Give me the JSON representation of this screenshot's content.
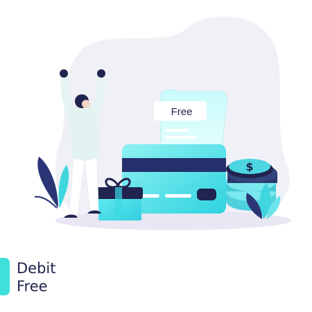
{
  "receipt": {
    "label": "Free"
  },
  "heading": {
    "line1": "Debit",
    "line2": "Free"
  },
  "colors": {
    "navy": "#20244e",
    "teal": "#3fe0dc",
    "cyan": "#5ee6ec",
    "blob": "#f0f0f7"
  },
  "icons": {
    "coin_symbol": "dollar"
  }
}
